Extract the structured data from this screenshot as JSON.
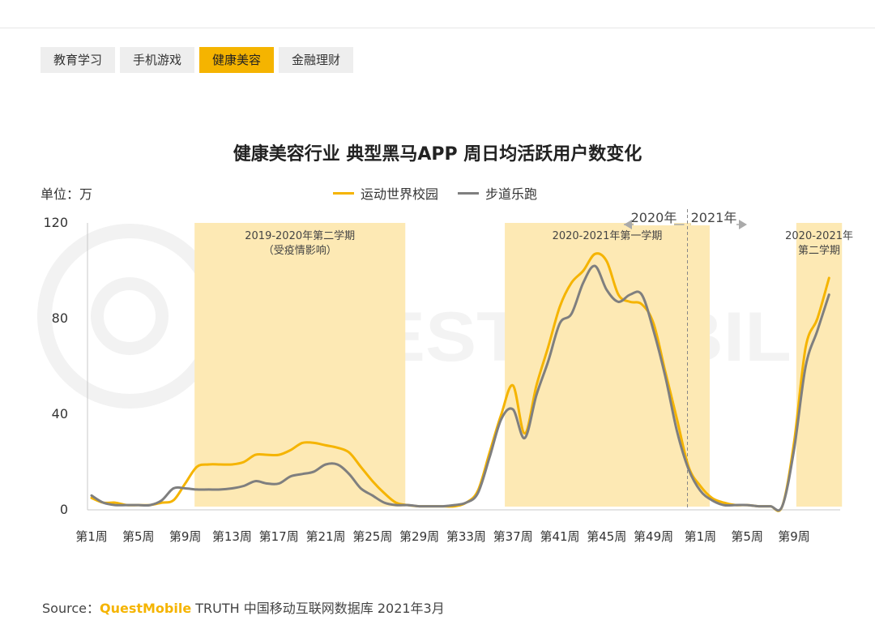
{
  "tabs": [
    {
      "label": "教育学习",
      "active": false
    },
    {
      "label": "手机游戏",
      "active": false
    },
    {
      "label": "健康美容",
      "active": true
    },
    {
      "label": "金融理财",
      "active": false
    }
  ],
  "watermark": "QUEST MOBILE",
  "source": {
    "prefix": "Source：",
    "brand": "QuestMobile",
    "text": " TRUTH 中国移动互联网数据库 2021年3月"
  },
  "colors": {
    "series1": "#f5b400",
    "series2": "#7f7f7f",
    "band": "#fde9b4"
  },
  "chart_data": {
    "type": "line",
    "title": "健康美容行业 典型黑马APP 周日均活跃用户数变化",
    "unit_label": "单位：万",
    "ylim": [
      0,
      120
    ],
    "yticks": [
      0,
      40,
      80,
      120
    ],
    "xlim": [
      0,
      73
    ],
    "x_ticks": [
      {
        "i": 0,
        "label": "第1周"
      },
      {
        "i": 4,
        "label": "第5周"
      },
      {
        "i": 8,
        "label": "第9周"
      },
      {
        "i": 12,
        "label": "第13周"
      },
      {
        "i": 16,
        "label": "第17周"
      },
      {
        "i": 20,
        "label": "第21周"
      },
      {
        "i": 24,
        "label": "第25周"
      },
      {
        "i": 28,
        "label": "第29周"
      },
      {
        "i": 32,
        "label": "第33周"
      },
      {
        "i": 36,
        "label": "第37周"
      },
      {
        "i": 40,
        "label": "第41周"
      },
      {
        "i": 44,
        "label": "第45周"
      },
      {
        "i": 48,
        "label": "第49周"
      },
      {
        "i": 52,
        "label": "第1周"
      },
      {
        "i": 56,
        "label": "第5周"
      },
      {
        "i": 60,
        "label": "第9周"
      }
    ],
    "bands": [
      {
        "start": 8.8,
        "end": 26.8,
        "label_lines": [
          "2019-2020年第二学期",
          "（受疫情影响）"
        ]
      },
      {
        "start": 35.3,
        "end": 52.8,
        "label_lines": [
          "2020-2021年第一学期"
        ]
      },
      {
        "start": 60.2,
        "end": 64.1,
        "label_lines": [
          "2020-2021年",
          "第二学期"
        ]
      }
    ],
    "divider": {
      "x": 50.9,
      "left_label": "2020年",
      "right_label": "2021年"
    },
    "series": [
      {
        "name": "运动世界校园",
        "x": [
          0,
          1,
          2,
          3,
          4,
          5,
          6,
          7,
          8,
          9,
          10,
          11,
          12,
          13,
          14,
          15,
          16,
          17,
          18,
          19,
          20,
          21,
          22,
          23,
          24,
          25,
          26,
          27,
          28,
          29,
          30,
          31,
          32,
          33,
          34,
          35,
          36,
          37,
          38,
          39,
          40,
          41,
          42,
          43,
          44,
          45,
          46,
          47,
          48,
          49,
          50,
          51,
          52,
          53,
          54,
          55,
          56,
          57,
          58,
          59,
          60,
          61,
          62,
          63
        ],
        "values": [
          5,
          3,
          3,
          2,
          2,
          2,
          3,
          4,
          11,
          18,
          19,
          19,
          19,
          20,
          23,
          23,
          23,
          25,
          28,
          28,
          27,
          26,
          24,
          18,
          12,
          7,
          3,
          2,
          1.5,
          1.5,
          1.5,
          1.5,
          3,
          8,
          24,
          40,
          52,
          32,
          52,
          68,
          85,
          95,
          100,
          107,
          104,
          90,
          87,
          86,
          78,
          58,
          38,
          18,
          10,
          5,
          3,
          2,
          2,
          1.5,
          1.5,
          1.5,
          28,
          68,
          80,
          97
        ]
      },
      {
        "name": "步道乐跑",
        "x": [
          0,
          1,
          2,
          3,
          4,
          5,
          6,
          7,
          8,
          9,
          10,
          11,
          12,
          13,
          14,
          15,
          16,
          17,
          18,
          19,
          20,
          21,
          22,
          23,
          24,
          25,
          26,
          27,
          28,
          29,
          30,
          31,
          32,
          33,
          34,
          35,
          36,
          37,
          38,
          39,
          40,
          41,
          42,
          43,
          44,
          45,
          46,
          47,
          48,
          49,
          50,
          51,
          52,
          53,
          54,
          55,
          56,
          57,
          58,
          59,
          60,
          61,
          62,
          63
        ],
        "values": [
          6,
          3,
          2,
          2,
          2,
          2,
          4,
          9,
          9,
          8.5,
          8.5,
          8.5,
          9,
          10,
          12,
          11,
          11,
          14,
          15,
          16,
          19,
          19,
          15,
          9,
          6,
          3,
          2,
          2,
          1.5,
          1.5,
          1.5,
          2,
          3,
          7,
          22,
          38,
          42,
          30,
          48,
          62,
          78,
          82,
          95,
          102,
          92,
          87,
          90,
          90,
          75,
          56,
          33,
          17,
          8,
          4,
          2,
          2,
          2,
          1.5,
          1.5,
          1.5,
          25,
          60,
          75,
          90
        ]
      }
    ]
  }
}
